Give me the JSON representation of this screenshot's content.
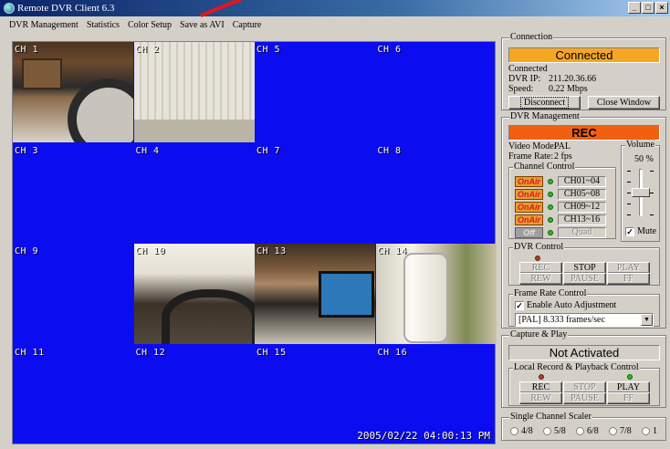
{
  "window": {
    "title": "Remote DVR Client 6.3"
  },
  "menu": [
    "DVR Management",
    "Statistics",
    "Color Setup",
    "Save as AVI",
    "Capture"
  ],
  "video": {
    "channels": [
      {
        "label": "CH 1",
        "feed": true
      },
      {
        "label": "CH 2",
        "feed": true
      },
      {
        "label": "CH 5",
        "feed": false
      },
      {
        "label": "CH 6",
        "feed": false
      },
      {
        "label": "CH 3",
        "feed": false
      },
      {
        "label": "CH 4",
        "feed": false
      },
      {
        "label": "CH 7",
        "feed": false
      },
      {
        "label": "CH 8",
        "feed": false
      },
      {
        "label": "CH 9",
        "feed": false
      },
      {
        "label": "CH 10",
        "feed": true
      },
      {
        "label": "CH 13",
        "feed": true
      },
      {
        "label": "CH 14",
        "feed": true
      },
      {
        "label": "CH 11",
        "feed": false
      },
      {
        "label": "CH 12",
        "feed": false
      },
      {
        "label": "CH 15",
        "feed": false
      },
      {
        "label": "CH 16",
        "feed": false
      }
    ],
    "timestamp": "2005/02/22 04:00:13 PM"
  },
  "connection": {
    "title": "Connection",
    "status": "Connected",
    "status_color": "#f5a623",
    "state_line": "Connected",
    "ip_label": "DVR IP:",
    "ip": "211.20.36.66",
    "speed_label": "Speed:",
    "speed": "0.22 Mbps",
    "disconnect": "Disconnect",
    "close": "Close Window"
  },
  "dvr_management": {
    "title": "DVR Management",
    "rec_status": "REC",
    "rec_color": "#f06010",
    "video_mode_label": "Video Mode:",
    "video_mode": "PAL",
    "frame_rate_label": "Frame Rate:",
    "frame_rate": "2 fps",
    "volume_title": "Volume",
    "volume": "50 %",
    "volume_level": 0.5,
    "mute_label": "Mute",
    "mute_checked": true,
    "channel_control": {
      "title": "Channel Control",
      "rows": [
        {
          "badge": "OnAir",
          "range": "CH01~04",
          "active": true
        },
        {
          "badge": "OnAir",
          "range": "CH05~08",
          "active": true
        },
        {
          "badge": "OnAir",
          "range": "CH09~12",
          "active": true
        },
        {
          "badge": "OnAir",
          "range": "CH13~16",
          "active": true
        },
        {
          "badge": "Off",
          "range": "Quad",
          "active": false
        }
      ]
    },
    "dvr_control": {
      "title": "DVR Control",
      "rec": "REC",
      "stop": "STOP",
      "play": "PLAY",
      "rew": "REW",
      "pause": "PAUSE",
      "ff": "FF"
    },
    "frame_rate_control": {
      "title": "Frame Rate Control",
      "auto_label": "Enable Auto Adjustment",
      "auto_checked": true,
      "selected": "[PAL] 8.333 frames/sec"
    }
  },
  "capture_play": {
    "title": "Capture & Play",
    "status": "Not Activated",
    "local_title": "Local Record & Playback Control",
    "rec": "REC",
    "stop": "STOP",
    "play": "PLAY",
    "rew": "REW",
    "pause": "PAUSE",
    "ff": "FF"
  },
  "scaler": {
    "title": "Single Channel Scaler",
    "options": [
      "4/8",
      "5/8",
      "6/8",
      "7/8",
      "1"
    ]
  }
}
